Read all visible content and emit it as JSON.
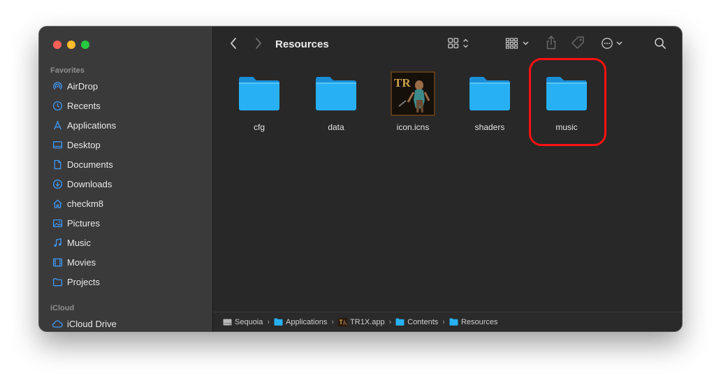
{
  "window": {
    "title": "Resources"
  },
  "sidebar": {
    "favorites_title": "Favorites",
    "items": [
      {
        "label": "AirDrop",
        "icon": "airdrop-icon"
      },
      {
        "label": "Recents",
        "icon": "clock-icon"
      },
      {
        "label": "Applications",
        "icon": "applications-icon"
      },
      {
        "label": "Desktop",
        "icon": "desktop-icon"
      },
      {
        "label": "Documents",
        "icon": "document-icon"
      },
      {
        "label": "Downloads",
        "icon": "download-icon"
      },
      {
        "label": "checkm8",
        "icon": "home-icon"
      },
      {
        "label": "Pictures",
        "icon": "pictures-icon"
      },
      {
        "label": "Music",
        "icon": "music-note-icon"
      },
      {
        "label": "Movies",
        "icon": "film-icon"
      },
      {
        "label": "Projects",
        "icon": "folder-icon"
      }
    ],
    "icloud_title": "iCloud",
    "icloud_item": {
      "label": "iCloud Drive",
      "icon": "cloud-icon"
    }
  },
  "files": [
    {
      "name": "cfg",
      "kind": "folder"
    },
    {
      "name": "data",
      "kind": "folder"
    },
    {
      "name": "icon.icns",
      "kind": "image"
    },
    {
      "name": "shaders",
      "kind": "folder"
    },
    {
      "name": "music",
      "kind": "folder",
      "highlighted": true
    }
  ],
  "pathbar": [
    {
      "label": "Sequoia",
      "icon": "disk-icon"
    },
    {
      "label": "Applications",
      "icon": "folder-icon"
    },
    {
      "label": "TR1X.app",
      "icon": "app-icon"
    },
    {
      "label": "Contents",
      "icon": "folder-icon"
    },
    {
      "label": "Resources",
      "icon": "folder-icon"
    }
  ],
  "icon_texts": {
    "tr_logo": "TR"
  },
  "colors": {
    "accent": "#3e98f3",
    "folder": "#27b1f4",
    "highlight": "#ff1010"
  }
}
